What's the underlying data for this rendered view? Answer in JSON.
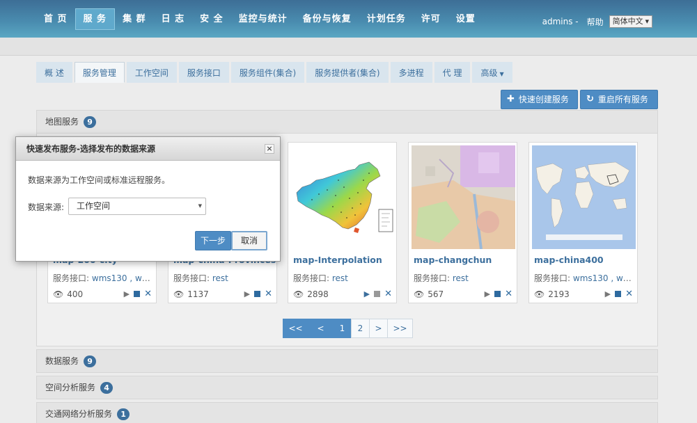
{
  "nav": {
    "items": [
      "首 页",
      "服 务",
      "集 群",
      "日 志",
      "安 全",
      "监控与统计",
      "备份与恢复",
      "计划任务",
      "许可",
      "设置"
    ],
    "active_index": 1,
    "user": "admins -",
    "help": "帮助",
    "language": "简体中文"
  },
  "tabs": {
    "items": [
      "概 述",
      "服务管理",
      "工作空间",
      "服务接口",
      "服务组件(集合)",
      "服务提供者(集合)",
      "多进程",
      "代 理",
      "高级"
    ],
    "active_index": 1
  },
  "actions": {
    "quick_create": "快速创建服务",
    "restart_all": "重启所有服务"
  },
  "panels": {
    "map": {
      "label": "地图服务",
      "count": "9"
    },
    "data": {
      "label": "数据服务",
      "count": "9"
    },
    "spatial": {
      "label": "空间分析服务",
      "count": "4"
    },
    "network": {
      "label": "交通网络分析服务",
      "count": "1"
    }
  },
  "cards": [
    {
      "title": "map-200-city",
      "iface_label": "服务接口:",
      "iface_value": "wms130 , wm...",
      "views": "400",
      "running": false
    },
    {
      "title": "map-china-Provinces",
      "iface_label": "服务接口:",
      "iface_value": "rest",
      "views": "1137",
      "running": false
    },
    {
      "title": "map-Interpolation",
      "iface_label": "服务接口:",
      "iface_value": "rest",
      "views": "2898",
      "running": true
    },
    {
      "title": "map-changchun",
      "iface_label": "服务接口:",
      "iface_value": "rest",
      "views": "567",
      "running": false
    },
    {
      "title": "map-china400",
      "iface_label": "服务接口:",
      "iface_value": "wms130 , wm...",
      "views": "2193",
      "running": false
    }
  ],
  "pager": {
    "first": "<<",
    "prev": "<",
    "pages": [
      "1",
      "2"
    ],
    "current": "1",
    "next": ">",
    "last": ">>"
  },
  "modal": {
    "title": "快速发布服务-选择发布的数据来源",
    "close": "×",
    "description": "数据来源为工作空间或标准远程服务。",
    "source_label": "数据来源:",
    "source_value": "工作空间",
    "next": "下一步",
    "cancel": "取消"
  },
  "colors": {
    "brand": "#4e8cc4",
    "link": "#3c6f9d",
    "stop_running": "#3c6f9d",
    "stop_idle": "#2e6a9f"
  }
}
